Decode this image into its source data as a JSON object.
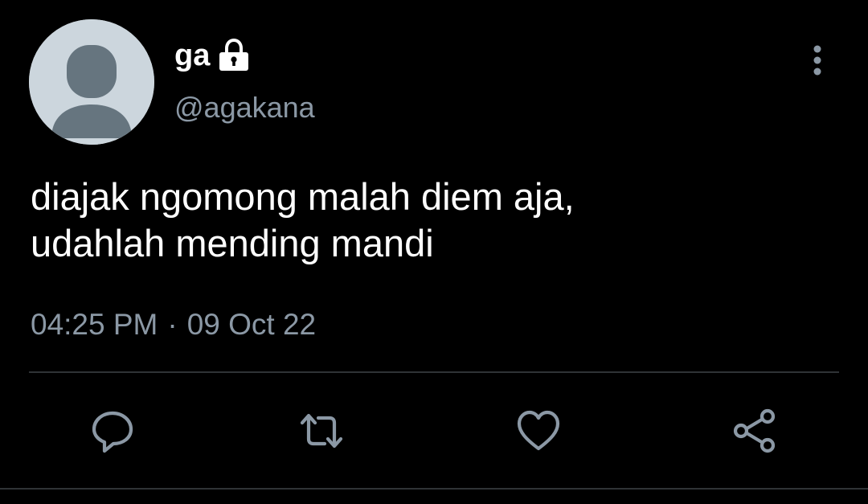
{
  "user": {
    "display_name": "ga",
    "handle": "@agakana",
    "protected": true
  },
  "tweet": {
    "text": "diajak ngomong malah diem aja,\nudahlah mending mandi",
    "time": "04:25 PM",
    "separator": "·",
    "date": "09 Oct 22"
  },
  "icons": {
    "avatar": "default-avatar-silhouette",
    "protected": "lock-icon",
    "more": "more-vertical-icon",
    "reply": "comment-icon",
    "retweet": "retweet-icon",
    "like": "heart-icon",
    "share": "share-icon"
  },
  "colors": {
    "background": "#000000",
    "text_primary": "#ffffff",
    "text_secondary": "#8b98a5",
    "divider": "#2f3336",
    "avatar_bg": "#ccd6dd",
    "avatar_figure": "#66757f"
  }
}
